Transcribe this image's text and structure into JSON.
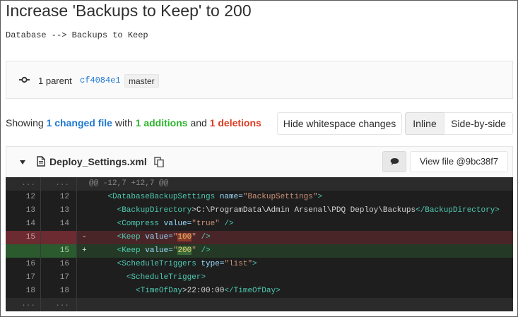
{
  "title": "Increase 'Backups to Keep' to 200",
  "description": "Database --> Backups to Keep",
  "commit_info": {
    "parent_label": "1 parent",
    "parent_sha": "cf4084e1",
    "branch": "master"
  },
  "stats": {
    "prefix": "Showing",
    "changed": "1 changed file",
    "with": "with",
    "additions": "1 additions",
    "and": "and",
    "deletions": "1 deletions"
  },
  "buttons": {
    "whitespace": "Hide whitespace changes",
    "inline": "Inline",
    "side_by_side": "Side-by-side"
  },
  "file": {
    "name": "Deploy_Settings.xml",
    "view_file": "View file @9bc38f7"
  },
  "diff": {
    "hunk_header": "@@ -12,7 +12,7 @@",
    "ellipsis": "...",
    "lines": [
      {
        "old": "12",
        "new": "12",
        "sign": " ",
        "indent": "    ",
        "tag_open": "<DatabaseBackupSettings",
        "attr": " name=",
        "val": "\"BackupSettings\"",
        "inner": "",
        "tag_close": ">"
      },
      {
        "old": "13",
        "new": "13",
        "sign": " ",
        "indent": "      ",
        "tag_open": "<BackupDirectory",
        "attr": "",
        "val": "",
        "inner": ">C:\\ProgramData\\Admin Arsenal\\PDQ Deploy\\Backups",
        "tag_close": "</BackupDirectory>"
      },
      {
        "old": "14",
        "new": "14",
        "sign": " ",
        "indent": "      ",
        "tag_open": "<Compress",
        "attr": " value=",
        "val": "\"true\"",
        "inner": "",
        "tag_close": " />"
      },
      {
        "old": "15",
        "new": "",
        "sign": "-",
        "indent": "      ",
        "tag_open": "<Keep",
        "attr": " value=",
        "val_pre": "\"",
        "val_hl": "100",
        "val_post": "\"",
        "tag_close": " />"
      },
      {
        "old": "",
        "new": "15",
        "sign": "+",
        "indent": "      ",
        "tag_open": "<Keep",
        "attr": " value=",
        "val_pre": "\"",
        "val_hl": "200",
        "val_post": "\"",
        "tag_close": " />"
      },
      {
        "old": "16",
        "new": "16",
        "sign": " ",
        "indent": "      ",
        "tag_open": "<ScheduleTriggers",
        "attr": " type=",
        "val": "\"list\"",
        "inner": "",
        "tag_close": ">"
      },
      {
        "old": "17",
        "new": "17",
        "sign": " ",
        "indent": "        ",
        "tag_open": "<ScheduleTrigger",
        "attr": "",
        "val": "",
        "inner": "",
        "tag_close": ">"
      },
      {
        "old": "18",
        "new": "18",
        "sign": " ",
        "indent": "          ",
        "tag_open": "<TimeOfDay",
        "attr": "",
        "val": "",
        "inner": ">22:00:00",
        "tag_close": "</TimeOfDay>"
      }
    ]
  }
}
